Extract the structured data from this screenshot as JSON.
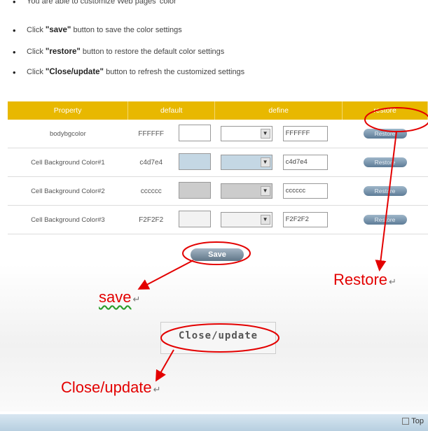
{
  "instructions": [
    {
      "pre": "You are able to customize Web pages' color",
      "bold": "",
      "post": ""
    },
    {
      "pre": "Click ",
      "bold": "\"save\"",
      "post": " button to save the color settings"
    },
    {
      "pre": "Click ",
      "bold": "\"restore\"",
      "post": " button to restore the default color settings"
    },
    {
      "pre": "Click ",
      "bold": "\"Close/update\"",
      "post": " button to refresh the customized settings"
    }
  ],
  "table": {
    "headers": {
      "property": "Property",
      "default": "default",
      "define": "define",
      "restore": "restore"
    },
    "rows": [
      {
        "property": "bodybgcolor",
        "default_code": "FFFFFF",
        "default_color": "#FFFFFF",
        "define_color": "#FFFFFF",
        "define_code": "FFFFFF",
        "restore_label": "Restore"
      },
      {
        "property": "Cell Background Color#1",
        "default_code": "c4d7e4",
        "default_color": "#c4d7e4",
        "define_color": "#c4d7e4",
        "define_code": "c4d7e4",
        "restore_label": "Restore"
      },
      {
        "property": "Cell Background Color#2",
        "default_code": "cccccc",
        "default_color": "#cccccc",
        "define_color": "#cccccc",
        "define_code": "cccccc",
        "restore_label": "Restore"
      },
      {
        "property": "Cell Background Color#3",
        "default_code": "F2F2F2",
        "default_color": "#F2F2F2",
        "define_color": "#F2F2F2",
        "define_code": "F2F2F2",
        "restore_label": "Restore"
      }
    ]
  },
  "save_button": "Save",
  "close_update_button": "Close/update",
  "annotations": {
    "save": "save",
    "restore": "Restore",
    "close_update": "Close/update",
    "return_mark": "↵"
  },
  "footer": {
    "top_link": "Top"
  },
  "colors": {
    "header_bg": "#e8b800",
    "annotation": "#e30000",
    "footer_bg": "#c6dae9"
  }
}
